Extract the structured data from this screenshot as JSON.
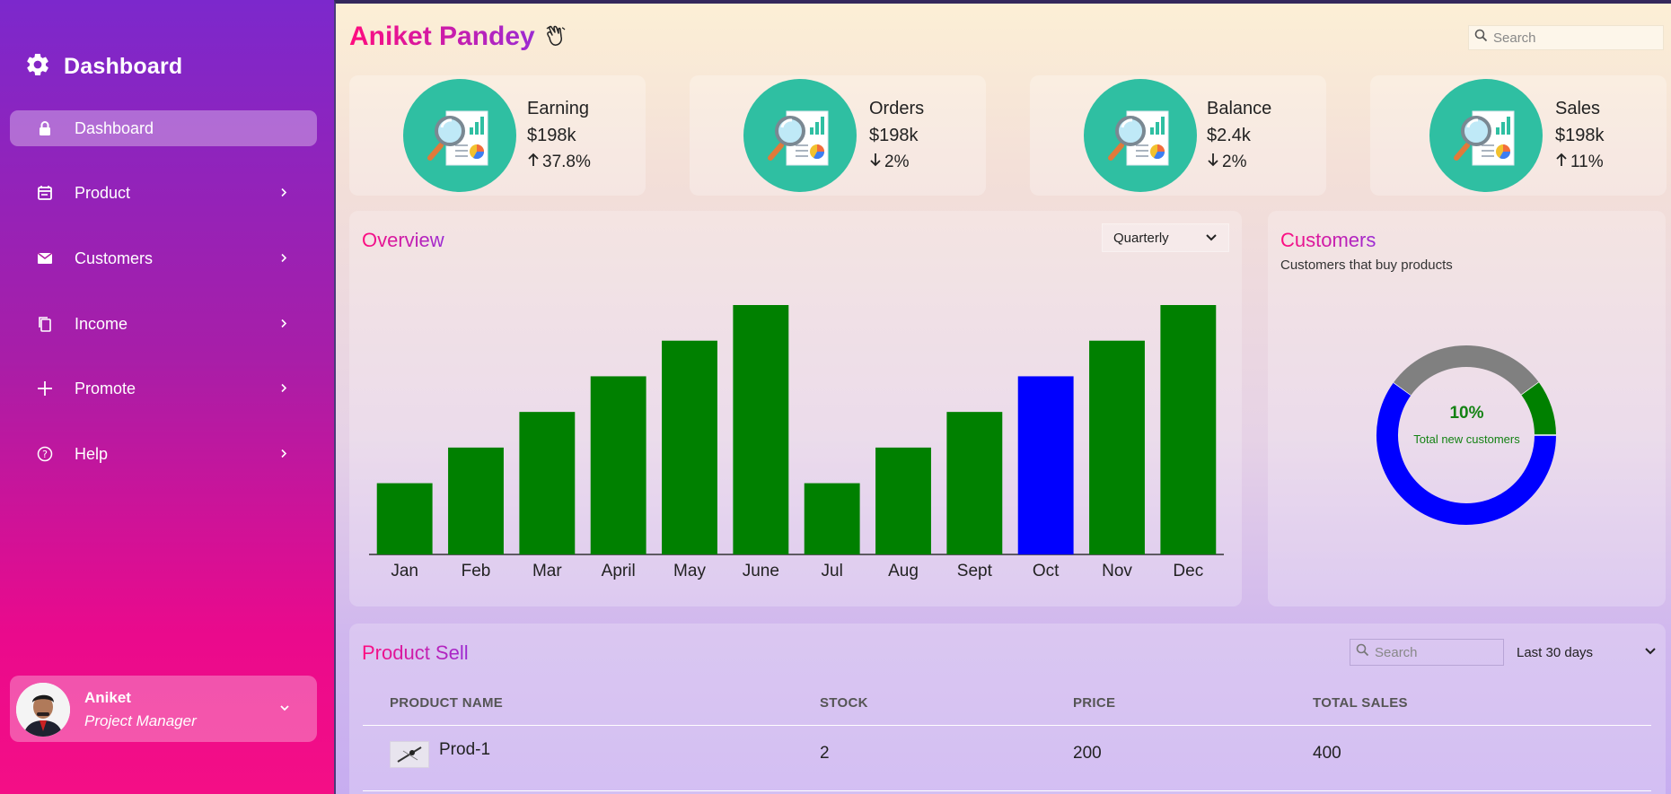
{
  "sidebar": {
    "brand": "Dashboard",
    "items": [
      {
        "label": "Dashboard",
        "icon": "lock-icon",
        "active": true
      },
      {
        "label": "Product",
        "icon": "calendar-icon"
      },
      {
        "label": "Customers",
        "icon": "mail-icon"
      },
      {
        "label": "Income",
        "icon": "copy-icon"
      },
      {
        "label": "Promote",
        "icon": "plus-icon"
      },
      {
        "label": "Help",
        "icon": "help-circle-icon"
      }
    ],
    "profile": {
      "name": "Aniket",
      "role": "Project Manager"
    }
  },
  "header": {
    "title": "Aniket Pandey",
    "search_placeholder": "Search"
  },
  "cards": [
    {
      "title": "Earning",
      "value": "$198k",
      "change": "37.8%",
      "direction": "up"
    },
    {
      "title": "Orders",
      "value": "$198k",
      "change": "2%",
      "direction": "down"
    },
    {
      "title": "Balance",
      "value": "$2.4k",
      "change": "2%",
      "direction": "down"
    },
    {
      "title": "Sales",
      "value": "$198k",
      "change": "11%",
      "direction": "up"
    }
  ],
  "overview": {
    "title": "Overview",
    "period": "Quarterly"
  },
  "customers": {
    "title": "Customers",
    "subtitle": "Customers that buy products",
    "percent": "10%",
    "center_label": "Total new customers"
  },
  "product_sell": {
    "title": "Product Sell",
    "search_placeholder": "Search",
    "period": "Last 30 days",
    "columns": [
      "PRODUCT NAME",
      "STOCK",
      "PRICE",
      "TOTAL SALES"
    ],
    "rows": [
      {
        "name": "Prod-1",
        "stock": "2",
        "price": "200",
        "total": "400"
      }
    ]
  },
  "colors": {
    "bar": "#008000",
    "highlight_bar": "#0000ff",
    "accent_pink": "#ff0c7e",
    "accent_purple": "#9b2bd3",
    "icon_teal": "#2fbfa2"
  },
  "chart_data": [
    {
      "type": "bar",
      "title": "Overview",
      "categories": [
        "Jan",
        "Feb",
        "Mar",
        "April",
        "May",
        "June",
        "Jul",
        "Aug",
        "Sept",
        "Oct",
        "Nov",
        "Dec"
      ],
      "values": [
        2,
        3,
        4,
        5,
        6,
        7,
        2,
        3,
        4,
        5,
        6,
        7
      ],
      "highlight_index": 9,
      "ylim": [
        0,
        7
      ],
      "grid": false
    },
    {
      "type": "pie",
      "title": "Customers",
      "categories": [
        "blue",
        "gray",
        "green"
      ],
      "values": [
        60,
        30,
        10
      ]
    }
  ]
}
